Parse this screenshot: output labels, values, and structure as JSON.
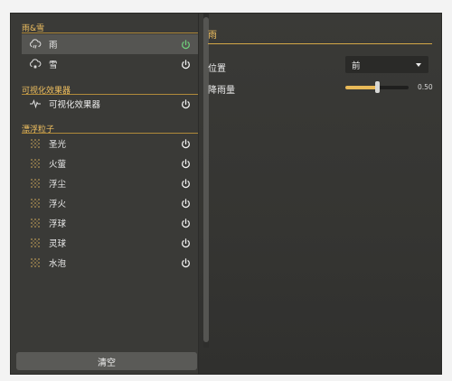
{
  "sections": [
    {
      "title": "雨&雪"
    },
    {
      "title": "可视化效果器"
    },
    {
      "title": "漂浮粒子"
    }
  ],
  "items": [
    {
      "label": "雨",
      "icon": "cloud-rain-icon",
      "power_on": true,
      "selected": true
    },
    {
      "label": "雪",
      "icon": "cloud-snow-icon",
      "power_on": false
    },
    {
      "label": "可视化效果器",
      "icon": "waveform-icon",
      "power_on": false
    },
    {
      "label": "圣光",
      "icon": "particles-icon",
      "power_on": false
    },
    {
      "label": "火萤",
      "icon": "particles-icon",
      "power_on": false
    },
    {
      "label": "浮尘",
      "icon": "particles-icon",
      "power_on": false
    },
    {
      "label": "浮火",
      "icon": "particles-icon",
      "power_on": false
    },
    {
      "label": "浮球",
      "icon": "particles-icon",
      "power_on": false
    },
    {
      "label": "灵球",
      "icon": "particles-icon",
      "power_on": false
    },
    {
      "label": "水泡",
      "icon": "particles-icon",
      "power_on": false
    }
  ],
  "clear_button": "清空",
  "detail": {
    "title": "雨",
    "position_label": "位置",
    "position_value": "前",
    "rainfall_label": "降雨量",
    "rainfall_value": "0.50",
    "rainfall_fraction": 0.5
  },
  "colors": {
    "accent": "#f0c060",
    "power_on": "#6fcf7a",
    "power_off": "#f2f2f2"
  }
}
